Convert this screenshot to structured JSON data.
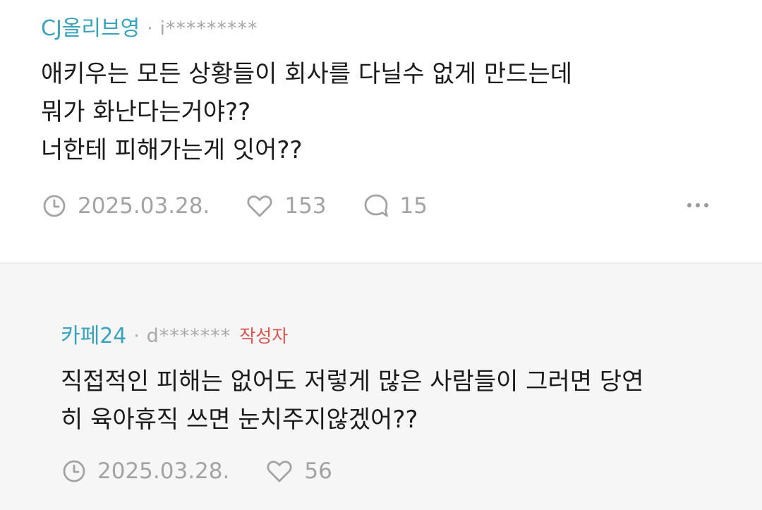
{
  "comments": [
    {
      "company": "CJ올리브영",
      "separator": "·",
      "user": "i*********",
      "lines": [
        "애키우는 모든 상황들이 회사를 다닐수 없게 만드는데",
        "뭐가 화난다는거야??",
        "너한테 피해가는게 잇어??"
      ],
      "date": "2025.03.28.",
      "likes": "153",
      "replies": "15"
    },
    {
      "company": "카페24",
      "separator": "·",
      "user": "d*******",
      "badge": "작성자",
      "lines": [
        "직접적인 피해는 없어도 저렇게 많은 사람들이 그러면 당연",
        "히 육아휴직 쓰면 눈치주지않겠어??"
      ],
      "date": "2025.03.28.",
      "likes": "56"
    }
  ],
  "colors": {
    "company": "#3aa3bb",
    "muted": "#a3a3a3",
    "badge": "#d9534f",
    "reply_bg": "#f6f6f6"
  },
  "icons": {
    "date": "clock-icon",
    "likes": "heart-icon",
    "replies": "speech-bubble-icon",
    "more": "more-dots-icon"
  }
}
